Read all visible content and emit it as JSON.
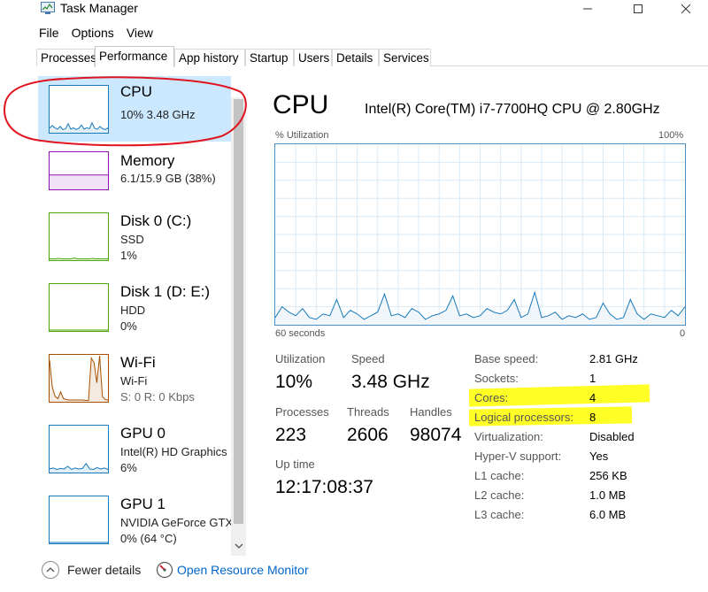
{
  "window": {
    "title": "Task Manager",
    "icon": "task-manager-icon"
  },
  "menu": [
    "File",
    "Options",
    "View"
  ],
  "tabs": [
    {
      "label": "Processes"
    },
    {
      "label": "Performance",
      "active": true
    },
    {
      "label": "App history"
    },
    {
      "label": "Startup"
    },
    {
      "label": "Users"
    },
    {
      "label": "Details"
    },
    {
      "label": "Services"
    }
  ],
  "sidebar": {
    "items": [
      {
        "title": "CPU",
        "line1": "10%  3.48 GHz",
        "line2": "",
        "color": "#1779ba",
        "selected": true
      },
      {
        "title": "Memory",
        "line1": "6.1/15.9 GB (38%)",
        "line2": "",
        "color": "#8b12ae"
      },
      {
        "title": "Disk 0 (C:)",
        "line1": "SSD",
        "line2": "1%",
        "color": "#4da60c"
      },
      {
        "title": "Disk 1 (D: E:)",
        "line1": "HDD",
        "line2": "0%",
        "color": "#4da60c"
      },
      {
        "title": "Wi-Fi",
        "line1": "Wi-Fi",
        "line2": "S: 0 R: 0 Kbps",
        "color": "#a74f01"
      },
      {
        "title": "GPU 0",
        "line1": "Intel(R) HD Graphics",
        "line2": "6%",
        "color": "#1779ba"
      },
      {
        "title": "GPU 1",
        "line1": "NVIDIA GeForce GTX",
        "line2": "0%  (64 °C)",
        "color": "#1779ba"
      }
    ]
  },
  "main": {
    "title": "CPU",
    "model": "Intel(R) Core(TM) i7-7700HQ CPU @ 2.80GHz",
    "graph": {
      "y_label": "% Utilization",
      "y_max_label": "100%",
      "x_label": "60 seconds",
      "x_min_label": "0",
      "line_color": "#1779ba",
      "fill_color": "#f1f6fa",
      "grid_color": "#d9eaf7",
      "values": [
        4,
        10,
        7,
        5,
        9,
        4,
        3,
        6,
        5,
        14,
        4,
        8,
        6,
        3,
        5,
        7,
        17,
        5,
        6,
        4,
        9,
        7,
        3,
        5,
        6,
        8,
        16,
        5,
        6,
        4,
        5,
        9,
        7,
        6,
        8,
        14,
        4,
        6,
        18,
        4,
        5,
        7,
        3,
        5,
        4,
        6,
        3,
        4,
        12,
        6,
        3,
        4,
        14,
        6,
        3,
        6,
        5,
        4,
        8,
        5,
        10
      ]
    },
    "stats": {
      "utilization": {
        "label": "Utilization",
        "value": "10%"
      },
      "speed": {
        "label": "Speed",
        "value": "3.48 GHz"
      },
      "processes": {
        "label": "Processes",
        "value": "223"
      },
      "threads": {
        "label": "Threads",
        "value": "2606"
      },
      "handles": {
        "label": "Handles",
        "value": "98074"
      },
      "uptime": {
        "label": "Up time",
        "value": "12:17:08:37"
      }
    },
    "info": [
      {
        "label": "Base speed:",
        "value": "2.81 GHz"
      },
      {
        "label": "Sockets:",
        "value": "1"
      },
      {
        "label": "Cores:",
        "value": "4",
        "highlight": true
      },
      {
        "label": "Logical processors:",
        "value": "8",
        "highlight": true
      },
      {
        "label": "Virtualization:",
        "value": "Disabled"
      },
      {
        "label": "Hyper-V support:",
        "value": "Yes"
      },
      {
        "label": "L1 cache:",
        "value": "256 KB"
      },
      {
        "label": "L2 cache:",
        "value": "1.0 MB"
      },
      {
        "label": "L3 cache:",
        "value": "6.0 MB"
      }
    ]
  },
  "footer": {
    "fewer_details": "Fewer details",
    "open_monitor": "Open Resource Monitor"
  },
  "colors": {
    "selected_bg": "#cce8ff",
    "highlight_yellow": "#ffff00",
    "annotation_red": "#e0141e",
    "link": "#0066cc"
  }
}
